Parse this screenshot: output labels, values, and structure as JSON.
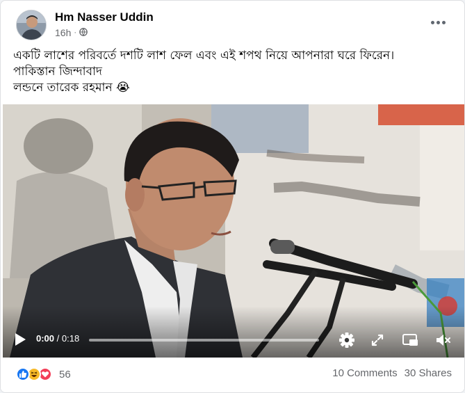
{
  "post": {
    "author": "Hm Nasser Uddin",
    "time": "16h",
    "dot": "·",
    "privacy_icon": "globe-icon",
    "text_lines": [
      "একটি লাশের পরিবর্তে দশটি লাশ ফেল এবং এই শপথ নিয়ে আপনারা ঘরে ফিরেন।",
      "পাকিস্তান জিন্দাবাদ",
      "লন্ডনে তারেক রহমান 😭"
    ]
  },
  "video": {
    "current_time": "0:00",
    "separator": " / ",
    "duration": "0:18",
    "progress": 0.0,
    "icons": [
      "play-icon",
      "settings-gear-icon",
      "fullscreen-expand-icon",
      "picture-in-picture-icon",
      "muted-speaker-icon"
    ]
  },
  "footer": {
    "reaction_icons": [
      "like-icon",
      "haha-icon",
      "love-icon"
    ],
    "reaction_count": "56",
    "comments": "10 Comments",
    "shares": "30 Shares"
  },
  "colors": {
    "like": "#1877f2",
    "haha": "#f7b928",
    "love": "#f33e58",
    "meta_text": "#65676b"
  }
}
